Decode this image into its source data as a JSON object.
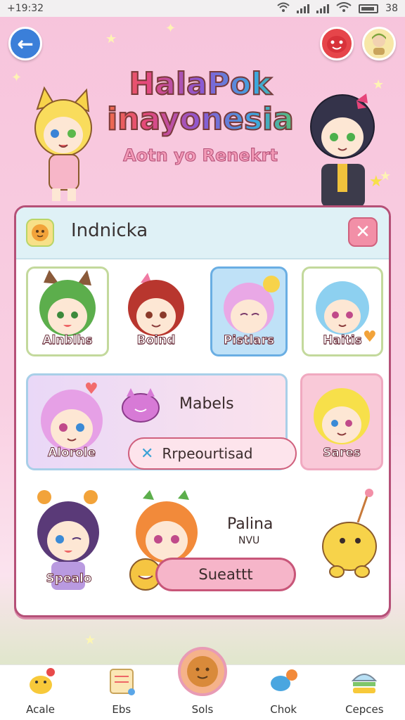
{
  "status_bar": {
    "time": "+19:32",
    "battery": "38"
  },
  "title": {
    "line1": "HalaPok",
    "line2": "inayonesia",
    "subtitle": "Aotn yo Renekrt"
  },
  "panel": {
    "title": "Indnicka",
    "close_label": "✕",
    "cards": [
      {
        "label": "Alnblhs",
        "selected": false
      },
      {
        "label": "Boind",
        "selected": false
      },
      {
        "label": "Pistlars",
        "selected": true
      },
      {
        "label": "Haitis",
        "selected": false
      }
    ],
    "wide_card": {
      "label": "Alorole",
      "name": "Mabels",
      "status": "Rrpeourtisad"
    },
    "pink_card": {
      "label": "Sares"
    },
    "bottom": {
      "label": "Spealo",
      "name": "Palina",
      "sub": "NVU",
      "button": "Sueattt"
    }
  },
  "nav": [
    {
      "label": "Acale",
      "icon": "duck-icon"
    },
    {
      "label": "Ebs",
      "icon": "notes-icon"
    },
    {
      "label": "Sols",
      "icon": "cookie-icon"
    },
    {
      "label": "Chok",
      "icon": "chat-icon"
    },
    {
      "label": "Cepces",
      "icon": "burger-icon"
    }
  ],
  "colors": {
    "accent": "#b55077",
    "back": "#3b7fd9",
    "pink": "#f7c4dc"
  }
}
